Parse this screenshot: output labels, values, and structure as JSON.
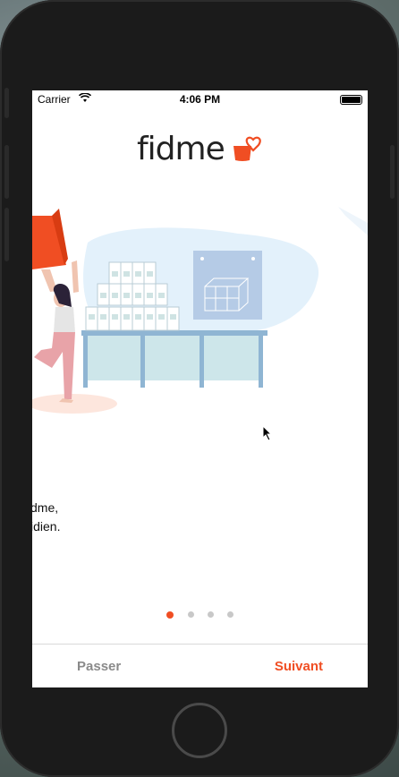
{
  "status_bar": {
    "carrier": "Carrier",
    "time": "4:06 PM",
    "wifi_icon": "wifi-icon",
    "battery_icon": "battery-icon"
  },
  "brand": {
    "name": "fidme",
    "logo_icon": "heart-cup-icon",
    "accent": "#f04e23"
  },
  "slide": {
    "caption_line1": "dme,",
    "caption_line2": "idien."
  },
  "pager": {
    "count": 4,
    "active_index": 0
  },
  "footer": {
    "skip_label": "Passer",
    "next_label": "Suivant"
  },
  "colors": {
    "accent": "#f04e23",
    "muted": "#8a8a8a",
    "dot_inactive": "#c8c8c8"
  }
}
